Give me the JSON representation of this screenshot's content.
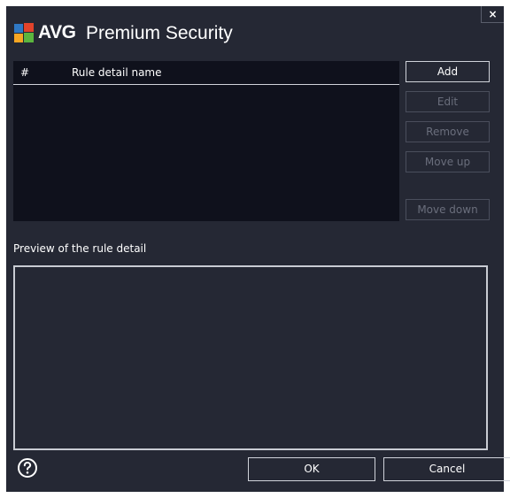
{
  "window": {
    "brand": "AVG",
    "product": "Premium Security",
    "close_glyph": "×"
  },
  "rules_table": {
    "columns": [
      "#",
      "Rule detail name"
    ],
    "rows": []
  },
  "side_buttons": [
    {
      "label": "Add",
      "enabled": true
    },
    {
      "label": "Edit",
      "enabled": false
    },
    {
      "label": "Remove",
      "enabled": false
    },
    {
      "label": "Move up",
      "enabled": false
    },
    {
      "label": "Move down",
      "enabled": false
    }
  ],
  "preview": {
    "label": "Preview of the rule detail",
    "content": ""
  },
  "footer": {
    "help_icon": "question-circle-icon",
    "ok_label": "OK",
    "cancel_label": "Cancel"
  },
  "colors": {
    "window_bg": "#252834",
    "table_bg": "#0f111c",
    "text": "#ffffff",
    "disabled_text": "#6a6e7c"
  }
}
